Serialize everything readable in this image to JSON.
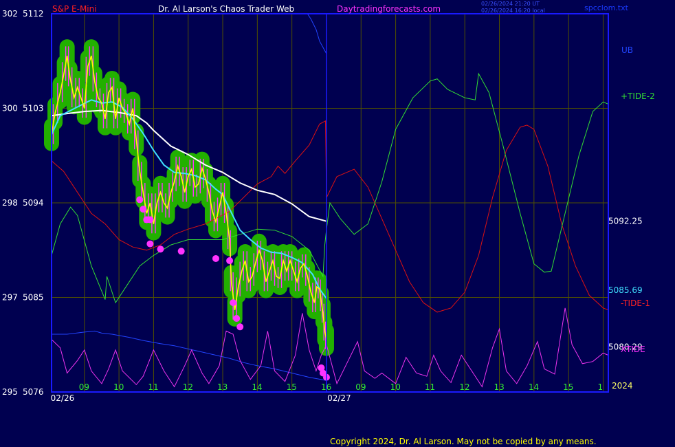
{
  "header": {
    "instrument": "S&P E-Mini",
    "site": "Dr. Al Larson's Chaos Trader Web",
    "url": "Daytradingforecasts.com",
    "timestamp1": "02/26/2024 21:20 UT",
    "timestamp2": "02/26/2024 16:20 local",
    "file": "spcclom.txt"
  },
  "footer": {
    "copyright": "Copyright 2024, Dr. Al Larson. May not be copied by any means."
  },
  "colors": {
    "background": "#000050",
    "frame": "#1a1aff",
    "grid": "#505000",
    "price_band": "#22b000",
    "price_line": "#ffff00",
    "price_bar": "#ff33ff",
    "avg_fast": "#40e0ff",
    "avg_slow": "#ffffff",
    "tide2": "#33dd33",
    "tide1": "#dd1111",
    "xtide": "#ee33ee",
    "ub": "#2244ff"
  },
  "chart_data": {
    "type": "line",
    "y_left_ticks": [
      {
        "tide": "302",
        "price": "5112",
        "value": 5112
      },
      {
        "tide": "300",
        "price": "5103",
        "value": 5103
      },
      {
        "tide": "298",
        "price": "5094",
        "value": 5094
      },
      {
        "tide": "297",
        "price": "5085",
        "value": 5085
      },
      {
        "tide": "295",
        "price": "5076",
        "value": 5076
      }
    ],
    "ylim": [
      5076,
      5112
    ],
    "x_hour_ticks": [
      {
        "label": "09",
        "x": 9
      },
      {
        "label": "10",
        "x": 10
      },
      {
        "label": "11",
        "x": 11
      },
      {
        "label": "12",
        "x": 12
      },
      {
        "label": "13",
        "x": 13
      },
      {
        "label": "14",
        "x": 14
      },
      {
        "label": "15",
        "x": 15
      },
      {
        "label": "16",
        "x": 16
      },
      {
        "label": "09",
        "x": 17
      },
      {
        "label": "10",
        "x": 18
      },
      {
        "label": "11",
        "x": 19
      },
      {
        "label": "12",
        "x": 20
      },
      {
        "label": "13",
        "x": 21
      },
      {
        "label": "14",
        "x": 22
      },
      {
        "label": "15",
        "x": 23
      },
      {
        "label": "1",
        "x": 24
      }
    ],
    "date_labels": [
      {
        "label": "02/26",
        "x": 8.5
      },
      {
        "label": "02/27",
        "x": 16.5
      }
    ],
    "xlim": [
      8.05,
      24.15
    ],
    "divider_x": 16.0,
    "year_label": "2024",
    "right_values": [
      {
        "label": "5092.25",
        "value": 5092.25
      },
      {
        "label": "5085.69",
        "value": 5085.69
      },
      {
        "label": "5080.29",
        "value": 5080.29
      }
    ],
    "legend": {
      "ub": "UB",
      "tide2": "+TIDE-2",
      "tide1": "-TIDE-1",
      "xtide": "XTIDE"
    },
    "price_close": [
      [
        8.05,
        5100.5
      ],
      [
        8.15,
        5102.5
      ],
      [
        8.3,
        5104.5
      ],
      [
        8.42,
        5106.5
      ],
      [
        8.5,
        5108
      ],
      [
        8.58,
        5106
      ],
      [
        8.7,
        5104
      ],
      [
        8.8,
        5105
      ],
      [
        8.9,
        5104
      ],
      [
        9.0,
        5103
      ],
      [
        9.1,
        5107
      ],
      [
        9.2,
        5108
      ],
      [
        9.3,
        5105.5
      ],
      [
        9.4,
        5104
      ],
      [
        9.5,
        5103.5
      ],
      [
        9.6,
        5102
      ],
      [
        9.7,
        5104.5
      ],
      [
        9.8,
        5105
      ],
      [
        9.9,
        5102
      ],
      [
        10.0,
        5104
      ],
      [
        10.1,
        5103
      ],
      [
        10.2,
        5102.5
      ],
      [
        10.3,
        5101.5
      ],
      [
        10.4,
        5103
      ],
      [
        10.5,
        5100
      ],
      [
        10.6,
        5097
      ],
      [
        10.7,
        5095
      ],
      [
        10.8,
        5093
      ],
      [
        10.9,
        5094
      ],
      [
        11.0,
        5092
      ],
      [
        11.1,
        5094
      ],
      [
        11.2,
        5095
      ],
      [
        11.3,
        5094
      ],
      [
        11.4,
        5093.5
      ],
      [
        11.5,
        5095
      ],
      [
        11.6,
        5096
      ],
      [
        11.7,
        5097.5
      ],
      [
        11.8,
        5096.5
      ],
      [
        11.9,
        5095
      ],
      [
        12.0,
        5096.5
      ],
      [
        12.1,
        5097.2
      ],
      [
        12.2,
        5095.5
      ],
      [
        12.3,
        5095.8
      ],
      [
        12.4,
        5097.3
      ],
      [
        12.5,
        5096.3
      ],
      [
        12.6,
        5095
      ],
      [
        12.7,
        5093.2
      ],
      [
        12.8,
        5092.2
      ],
      [
        12.9,
        5093.6
      ],
      [
        13.0,
        5095
      ],
      [
        13.1,
        5093
      ],
      [
        13.2,
        5090.5
      ],
      [
        13.25,
        5086.5
      ],
      [
        13.35,
        5083.8
      ],
      [
        13.45,
        5086
      ],
      [
        13.55,
        5087.5
      ],
      [
        13.65,
        5088.5
      ],
      [
        13.75,
        5086.5
      ],
      [
        13.85,
        5087
      ],
      [
        13.95,
        5088.3
      ],
      [
        14.05,
        5089.5
      ],
      [
        14.15,
        5088.5
      ],
      [
        14.25,
        5086.5
      ],
      [
        14.35,
        5087.5
      ],
      [
        14.45,
        5088.5
      ],
      [
        14.55,
        5087
      ],
      [
        14.65,
        5086.8
      ],
      [
        14.75,
        5088.5
      ],
      [
        14.85,
        5087.5
      ],
      [
        14.95,
        5088.5
      ],
      [
        15.05,
        5087.5
      ],
      [
        15.15,
        5086.5
      ],
      [
        15.25,
        5087.8
      ],
      [
        15.35,
        5088.2
      ],
      [
        15.45,
        5087
      ],
      [
        15.55,
        5085.5
      ],
      [
        15.65,
        5084.5
      ],
      [
        15.72,
        5086
      ],
      [
        15.8,
        5085.8
      ],
      [
        15.85,
        5084.6
      ],
      [
        15.9,
        5083.5
      ],
      [
        15.95,
        5081.8
      ],
      [
        16.0,
        5081
      ]
    ],
    "avg_fast": [
      [
        8.05,
        5100.5
      ],
      [
        8.3,
        5102.3
      ],
      [
        8.6,
        5102.8
      ],
      [
        8.9,
        5103.3
      ],
      [
        9.2,
        5103.8
      ],
      [
        9.5,
        5103.5
      ],
      [
        9.8,
        5103.6
      ],
      [
        10.1,
        5103.1
      ],
      [
        10.4,
        5102
      ],
      [
        10.7,
        5100.6
      ],
      [
        11.0,
        5099
      ],
      [
        11.3,
        5097.6
      ],
      [
        11.6,
        5096.9
      ],
      [
        11.9,
        5096.8
      ],
      [
        12.2,
        5096.6
      ],
      [
        12.5,
        5096.2
      ],
      [
        12.8,
        5095.3
      ],
      [
        13.0,
        5094.8
      ],
      [
        13.2,
        5093.4
      ],
      [
        13.5,
        5091.4
      ],
      [
        13.8,
        5090.5
      ],
      [
        14.1,
        5089.7
      ],
      [
        14.4,
        5089.3
      ],
      [
        14.7,
        5089.2
      ],
      [
        15.0,
        5088.8
      ],
      [
        15.3,
        5088.3
      ],
      [
        15.6,
        5087.2
      ],
      [
        15.8,
        5085.8
      ],
      [
        16.0,
        5084.9
      ]
    ],
    "avg_slow": [
      [
        8.05,
        5102.3
      ],
      [
        8.5,
        5102.5
      ],
      [
        9.0,
        5102.7
      ],
      [
        9.5,
        5102.8
      ],
      [
        10.0,
        5102.6
      ],
      [
        10.5,
        5102.3
      ],
      [
        10.8,
        5101.6
      ],
      [
        11.0,
        5100.9
      ],
      [
        11.5,
        5099.4
      ],
      [
        12.0,
        5098.6
      ],
      [
        12.5,
        5097.6
      ],
      [
        13.0,
        5096.9
      ],
      [
        13.5,
        5095.9
      ],
      [
        14.0,
        5095.2
      ],
      [
        14.5,
        5094.8
      ],
      [
        15.0,
        5093.9
      ],
      [
        15.5,
        5092.7
      ],
      [
        16.0,
        5092.25
      ]
    ],
    "tide2": [
      [
        8.05,
        5089
      ],
      [
        8.3,
        5092
      ],
      [
        8.6,
        5093.6
      ],
      [
        8.8,
        5092.8
      ],
      [
        9.2,
        5088
      ],
      [
        9.6,
        5084.8
      ],
      [
        9.65,
        5087
      ],
      [
        9.9,
        5084.5
      ],
      [
        10.2,
        5086
      ],
      [
        10.6,
        5088
      ],
      [
        11.0,
        5089
      ],
      [
        11.5,
        5090
      ],
      [
        12.0,
        5090.5
      ],
      [
        12.5,
        5090.5
      ],
      [
        13.0,
        5090.5
      ],
      [
        13.5,
        5091
      ],
      [
        14.0,
        5091.5
      ],
      [
        14.5,
        5091.4
      ],
      [
        15.0,
        5090.8
      ],
      [
        15.5,
        5089.5
      ],
      [
        15.9,
        5087
      ],
      [
        15.95,
        5090
      ],
      [
        16.0,
        5091.5
      ],
      [
        16.1,
        5094
      ],
      [
        16.4,
        5092.5
      ],
      [
        16.8,
        5091
      ],
      [
        17.2,
        5092
      ],
      [
        17.6,
        5096
      ],
      [
        18.0,
        5101
      ],
      [
        18.5,
        5104
      ],
      [
        19.0,
        5105.6
      ],
      [
        19.2,
        5105.8
      ],
      [
        19.5,
        5104.8
      ],
      [
        20.0,
        5104
      ],
      [
        20.3,
        5103.8
      ],
      [
        20.4,
        5106.3
      ],
      [
        20.7,
        5104.5
      ],
      [
        21.1,
        5099.5
      ],
      [
        21.6,
        5093
      ],
      [
        22.0,
        5088.2
      ],
      [
        22.3,
        5087.4
      ],
      [
        22.5,
        5087.5
      ],
      [
        22.9,
        5093
      ],
      [
        23.3,
        5098.5
      ],
      [
        23.7,
        5102.7
      ],
      [
        24.0,
        5103.6
      ],
      [
        24.15,
        5103.4
      ]
    ],
    "tide1": [
      [
        8.05,
        5098
      ],
      [
        8.4,
        5097
      ],
      [
        8.8,
        5095
      ],
      [
        9.2,
        5093
      ],
      [
        9.6,
        5092
      ],
      [
        10.0,
        5090.5
      ],
      [
        10.4,
        5089.8
      ],
      [
        10.8,
        5089.5
      ],
      [
        11.2,
        5090
      ],
      [
        11.6,
        5091
      ],
      [
        12.0,
        5091.5
      ],
      [
        12.5,
        5092
      ],
      [
        12.8,
        5092.5
      ],
      [
        13.2,
        5093.2
      ],
      [
        13.6,
        5094.5
      ],
      [
        14.0,
        5095.8
      ],
      [
        14.4,
        5096.5
      ],
      [
        14.6,
        5097.5
      ],
      [
        14.8,
        5096.8
      ],
      [
        15.1,
        5098
      ],
      [
        15.5,
        5099.5
      ],
      [
        15.8,
        5101.5
      ],
      [
        15.97,
        5101.8
      ],
      [
        16.0,
        5094.5
      ],
      [
        16.3,
        5096.5
      ],
      [
        16.8,
        5097.2
      ],
      [
        17.2,
        5095.5
      ],
      [
        17.6,
        5092.5
      ],
      [
        18.0,
        5089.5
      ],
      [
        18.4,
        5086.5
      ],
      [
        18.8,
        5084.5
      ],
      [
        19.2,
        5083.6
      ],
      [
        19.6,
        5084
      ],
      [
        20.0,
        5085.5
      ],
      [
        20.4,
        5089
      ],
      [
        20.8,
        5094.5
      ],
      [
        21.2,
        5099
      ],
      [
        21.6,
        5101.2
      ],
      [
        21.8,
        5101.4
      ],
      [
        22.0,
        5101
      ],
      [
        22.4,
        5097.5
      ],
      [
        22.8,
        5092
      ],
      [
        23.2,
        5088
      ],
      [
        23.6,
        5085.2
      ],
      [
        24.0,
        5084
      ],
      [
        24.15,
        5083.8
      ]
    ],
    "xtide": [
      [
        8.05,
        5081
      ],
      [
        8.3,
        5080.2
      ],
      [
        8.5,
        5077.8
      ],
      [
        8.8,
        5079
      ],
      [
        9.0,
        5080
      ],
      [
        9.2,
        5078
      ],
      [
        9.5,
        5076.8
      ],
      [
        9.7,
        5078.2
      ],
      [
        9.9,
        5080
      ],
      [
        10.1,
        5078
      ],
      [
        10.5,
        5076.7
      ],
      [
        10.7,
        5077.5
      ],
      [
        11.0,
        5080
      ],
      [
        11.3,
        5078
      ],
      [
        11.6,
        5076.5
      ],
      [
        11.9,
        5078.5
      ],
      [
        12.1,
        5080
      ],
      [
        12.4,
        5077.8
      ],
      [
        12.6,
        5076.8
      ],
      [
        12.9,
        5078.5
      ],
      [
        13.1,
        5081.8
      ],
      [
        13.3,
        5081.5
      ],
      [
        13.5,
        5079
      ],
      [
        13.8,
        5077.2
      ],
      [
        14.1,
        5078.5
      ],
      [
        14.3,
        5081.8
      ],
      [
        14.5,
        5078
      ],
      [
        14.8,
        5077
      ],
      [
        15.1,
        5079.5
      ],
      [
        15.3,
        5083.5
      ],
      [
        15.5,
        5080
      ],
      [
        15.7,
        5078
      ],
      [
        15.85,
        5079.5
      ],
      [
        16.0,
        5080.5
      ],
      [
        16.3,
        5076.8
      ],
      [
        16.6,
        5078.8
      ],
      [
        16.9,
        5080.8
      ],
      [
        17.1,
        5078
      ],
      [
        17.4,
        5077.3
      ],
      [
        17.6,
        5077.8
      ],
      [
        18.0,
        5076.8
      ],
      [
        18.3,
        5079.3
      ],
      [
        18.6,
        5077.8
      ],
      [
        18.9,
        5077.5
      ],
      [
        19.1,
        5079.5
      ],
      [
        19.3,
        5078
      ],
      [
        19.6,
        5076.9
      ],
      [
        19.9,
        5079.5
      ],
      [
        20.2,
        5078
      ],
      [
        20.5,
        5076.5
      ],
      [
        20.8,
        5080.2
      ],
      [
        21.0,
        5082
      ],
      [
        21.2,
        5078
      ],
      [
        21.5,
        5076.8
      ],
      [
        21.8,
        5078.5
      ],
      [
        22.1,
        5080.8
      ],
      [
        22.3,
        5078.2
      ],
      [
        22.6,
        5077.7
      ],
      [
        22.9,
        5084
      ],
      [
        23.1,
        5080.5
      ],
      [
        23.4,
        5078.7
      ],
      [
        23.7,
        5078.9
      ],
      [
        24.0,
        5079.7
      ],
      [
        24.15,
        5079.5
      ]
    ],
    "ub": [
      [
        8.05,
        5081.5
      ],
      [
        8.5,
        5081.5
      ],
      [
        9.0,
        5081.7
      ],
      [
        9.3,
        5081.8
      ],
      [
        9.5,
        5081.6
      ],
      [
        9.8,
        5081.5
      ],
      [
        10.3,
        5081.2
      ],
      [
        10.7,
        5080.9
      ],
      [
        11.2,
        5080.6
      ],
      [
        11.6,
        5080.4
      ],
      [
        12.0,
        5080.1
      ],
      [
        12.4,
        5079.8
      ],
      [
        12.8,
        5079.5
      ],
      [
        13.2,
        5079.2
      ],
      [
        13.6,
        5078.8
      ],
      [
        14.0,
        5078.5
      ],
      [
        14.5,
        5078.2
      ],
      [
        15.0,
        5077.8
      ],
      [
        15.5,
        5077.4
      ],
      [
        16.0,
        5077.1
      ]
    ],
    "ub_late": [
      [
        15.45,
        5112
      ],
      [
        15.55,
        5111.5
      ],
      [
        15.7,
        5110.5
      ],
      [
        15.8,
        5109.4
      ],
      [
        15.9,
        5108.8
      ],
      [
        16.0,
        5108.2
      ]
    ],
    "pivots": [
      [
        10.6,
        5094.3
      ],
      [
        10.7,
        5093.4
      ],
      [
        10.8,
        5092.4
      ],
      [
        10.9,
        5092.4
      ],
      [
        10.9,
        5090.1
      ],
      [
        11.2,
        5089.6
      ],
      [
        11.8,
        5089.4
      ],
      [
        12.8,
        5088.7
      ],
      [
        13.2,
        5088.5
      ],
      [
        13.3,
        5084.5
      ],
      [
        13.4,
        5083
      ],
      [
        13.5,
        5082.2
      ],
      [
        15.85,
        5078.3
      ],
      [
        15.9,
        5077.8
      ],
      [
        16.0,
        5077.4
      ]
    ]
  }
}
